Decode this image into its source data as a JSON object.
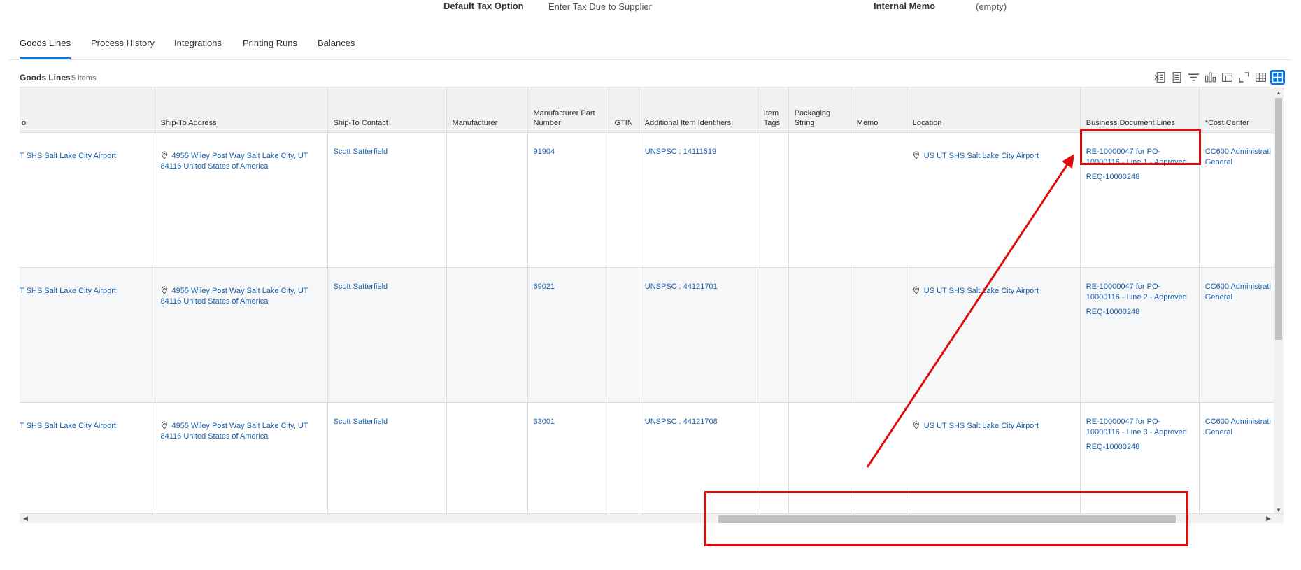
{
  "top_info": {
    "default_tax_option_label": "Default Tax Option",
    "default_tax_option_value": "Enter Tax Due to Supplier",
    "internal_memo_label": "Internal Memo",
    "internal_memo_value": "(empty)"
  },
  "tabs": [
    {
      "label": "Goods Lines",
      "active": true
    },
    {
      "label": "Process History"
    },
    {
      "label": "Integrations"
    },
    {
      "label": "Printing Runs"
    },
    {
      "label": "Balances"
    }
  ],
  "section": {
    "title": "Goods Lines",
    "count": "5 items"
  },
  "toolbar": {
    "icons": [
      "export-excel-icon",
      "export-pdf-icon",
      "filter-icon",
      "chart-icon",
      "column-chooser-icon",
      "fullscreen-icon",
      "table-view-icon",
      "grid-view-icon"
    ],
    "accent_color": "#0875e1"
  },
  "table": {
    "headers": [
      "o",
      "Ship-To Address",
      "Ship-To Contact",
      "Manufacturer",
      "Manufacturer Part Number",
      "GTIN",
      "Additional Item Identifiers",
      "Item Tags",
      "Packaging String",
      "Memo",
      "Location",
      "Business Document Lines",
      "*Cost Center"
    ],
    "rows": [
      {
        "ship_to": "T SHS Salt Lake City Airport",
        "address": "4955 Wiley Post Way Salt Lake City, UT 84116 United States of America",
        "contact": "Scott Satterfield",
        "manufacturer": "",
        "part_number": "91904",
        "gtin": "",
        "identifiers": "UNSPSC : 14111519",
        "item_tags": "",
        "packaging": "",
        "memo": "",
        "location": "US UT SHS Salt Lake City Airport",
        "bdl_1": "RE-10000047 for PO-10000116 - Line 1 - Approved",
        "bdl_2": "REQ-10000248",
        "cost_center": "CC600 Administrati General"
      },
      {
        "ship_to": "T SHS Salt Lake City Airport",
        "address": "4955 Wiley Post Way Salt Lake City, UT 84116 United States of America",
        "contact": "Scott Satterfield",
        "manufacturer": "",
        "part_number": "69021",
        "gtin": "",
        "identifiers": "UNSPSC : 44121701",
        "item_tags": "",
        "packaging": "",
        "memo": "",
        "location": "US UT SHS Salt Lake City Airport",
        "bdl_1": "RE-10000047 for PO-10000116 - Line 2 - Approved",
        "bdl_2": "REQ-10000248",
        "cost_center": "CC600 Administrati General"
      },
      {
        "ship_to": "T SHS Salt Lake City Airport",
        "address": "4955 Wiley Post Way Salt Lake City, UT 84116 United States of America",
        "contact": "Scott Satterfield",
        "manufacturer": "",
        "part_number": "33001",
        "gtin": "",
        "identifiers": "UNSPSC : 44121708",
        "item_tags": "",
        "packaging": "",
        "memo": "",
        "location": "US UT SHS Salt Lake City Airport",
        "bdl_1": "RE-10000047 for PO-10000116 - Line 3 - Approved",
        "bdl_2": "REQ-10000248",
        "cost_center": "CC600 Administrati General"
      }
    ]
  },
  "colors": {
    "link": "#1a5fa8",
    "annotation": "#e10d0d",
    "header_bg": "#f0f1f2"
  }
}
